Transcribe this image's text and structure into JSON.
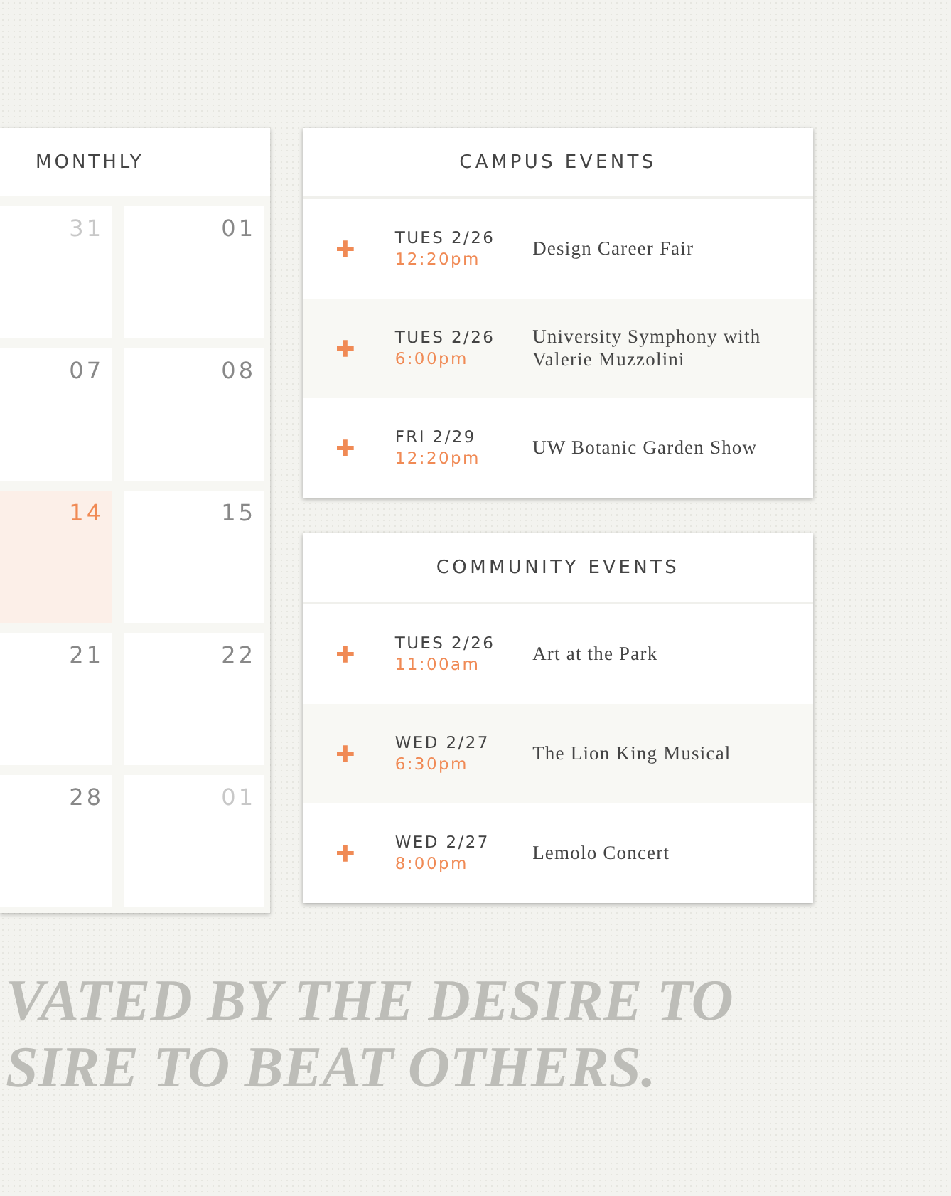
{
  "calendar": {
    "title": "MONTHLY",
    "weeks": [
      [
        {
          "day": "31",
          "other_month": true,
          "selected": false
        },
        {
          "day": "01",
          "other_month": false,
          "selected": false
        }
      ],
      [
        {
          "day": "07",
          "other_month": false,
          "selected": false
        },
        {
          "day": "08",
          "other_month": false,
          "selected": false
        }
      ],
      [
        {
          "day": "14",
          "other_month": false,
          "selected": true
        },
        {
          "day": "15",
          "other_month": false,
          "selected": false
        }
      ],
      [
        {
          "day": "21",
          "other_month": false,
          "selected": false
        },
        {
          "day": "22",
          "other_month": false,
          "selected": false
        }
      ],
      [
        {
          "day": "28",
          "other_month": false,
          "selected": false
        },
        {
          "day": "01",
          "other_month": true,
          "selected": false
        }
      ]
    ]
  },
  "event_panels": [
    {
      "title": "CAMPUS EVENTS",
      "events": [
        {
          "date": "TUES 2/26",
          "time": "12:20pm",
          "name": "Design Career Fair"
        },
        {
          "date": "TUES 2/26",
          "time": "6:00pm",
          "name": "University Symphony with Valerie Muzzolini"
        },
        {
          "date": "FRI 2/29",
          "time": "12:20pm",
          "name": "UW Botanic Garden Show"
        }
      ]
    },
    {
      "title": "COMMUNITY EVENTS",
      "events": [
        {
          "date": "TUES 2/26",
          "time": "11:00am",
          "name": "Art at the Park"
        },
        {
          "date": "WED 2/27",
          "time": "6:30pm",
          "name": "The Lion King Musical"
        },
        {
          "date": "WED 2/27",
          "time": "8:00pm",
          "name": "Lemolo Concert"
        }
      ]
    }
  ],
  "quote_lines": [
    "VATED BY THE DESIRE TO",
    "SIRE TO BEAT OTHERS."
  ]
}
